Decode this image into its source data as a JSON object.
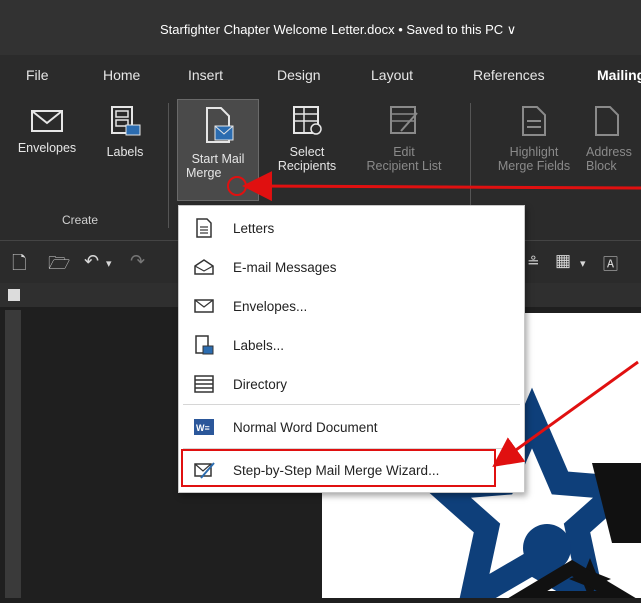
{
  "window": {
    "title": "Starfighter Chapter Welcome Letter.docx  •  Saved to this PC ∨"
  },
  "tabs": [
    "File",
    "Home",
    "Insert",
    "Design",
    "Layout",
    "References",
    "Mailing"
  ],
  "ribbon": {
    "envelopes": "Envelopes",
    "labels": "Labels",
    "start_mail_merge_line1": "Start Mail",
    "start_mail_merge_line2": "Merge",
    "select_recipients_line1": "Select",
    "select_recipients_line2": "Recipients",
    "edit_recipient_list_line1": "Edit",
    "edit_recipient_list_line2": "Recipient List",
    "highlight_merge_fields_line1": "Highlight",
    "highlight_merge_fields_line2": "Merge Fields",
    "address_block_line1": "Address",
    "address_block_line2": "Block",
    "group_create": "Create"
  },
  "menu": {
    "items": [
      {
        "label": "Letters",
        "icon": "letter-icon"
      },
      {
        "label": "E-mail Messages",
        "icon": "email-icon"
      },
      {
        "label": "Envelopes...",
        "icon": "envelope-icon"
      },
      {
        "label": "Labels...",
        "icon": "labels-icon"
      },
      {
        "label": "Directory",
        "icon": "directory-icon"
      },
      {
        "label": "Normal Word Document",
        "icon": "word-icon"
      },
      {
        "label": "Step-by-Step Mail Merge Wizard...",
        "icon": "wizard-icon"
      }
    ]
  },
  "annotation": {
    "color": "#e01010"
  }
}
